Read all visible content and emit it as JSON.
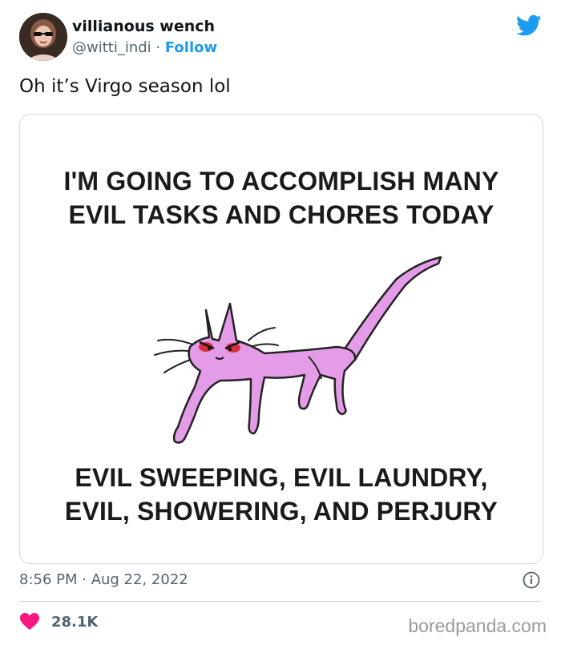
{
  "author": {
    "display_name": "villianous wench",
    "handle": "@witti_indi",
    "separator": " · ",
    "follow_label": "Follow"
  },
  "tweet": {
    "text": "Oh it’s Virgo season lol",
    "timestamp": "8:56 PM · Aug 22, 2022",
    "likes": "28.1K"
  },
  "meme": {
    "top_text": "I'M GOING TO ACCOMPLISH MANY\nEVIL TASKS AND CHORES TODAY",
    "bottom_text": "EVIL SWEEPING, EVIL LAUNDRY,\nEVIL, SHOWERING, AND PERJURY"
  },
  "icons": {
    "brand": "twitter-bird-icon",
    "info": "info-icon",
    "like": "heart-icon"
  },
  "colors": {
    "twitter_blue": "#1d9bf0",
    "like_pink": "#f91880",
    "cat_pink": "#e59ce8",
    "eye_red": "#d01f1f"
  },
  "watermark": "boredpanda.com"
}
